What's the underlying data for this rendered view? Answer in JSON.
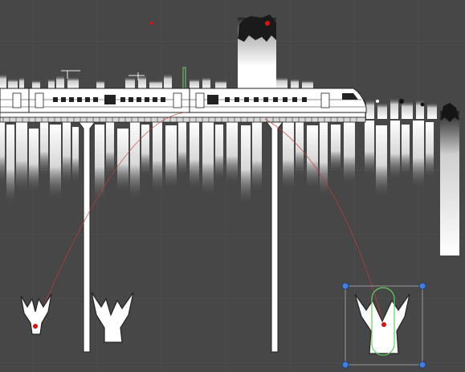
{
  "scene": {
    "view": "scene-view",
    "grid": true,
    "background_color": "#474747",
    "grid_color": "#525252",
    "accent_red": "#e01010",
    "selection_color": "#3f7fe0",
    "collider_color": "#5fd05f"
  },
  "objects": [
    {
      "name": "city-skyline-sprite",
      "icon": "skyline"
    },
    {
      "name": "bridge-sprite",
      "icon": "bridge"
    },
    {
      "name": "high-speed-train-sprite",
      "icon": "train"
    },
    {
      "name": "tall-tower-sprite",
      "icon": "tower"
    },
    {
      "name": "right-tower-sprite",
      "icon": "tower"
    },
    {
      "name": "tree-sprite-left",
      "icon": "tree"
    },
    {
      "name": "tree-sprite-middle",
      "icon": "tree"
    },
    {
      "name": "tree-sprite-selected",
      "icon": "tree",
      "selected": true
    }
  ],
  "gizmos": {
    "path_lines": 2,
    "pivot_points": 4,
    "selection_handles": 4
  }
}
